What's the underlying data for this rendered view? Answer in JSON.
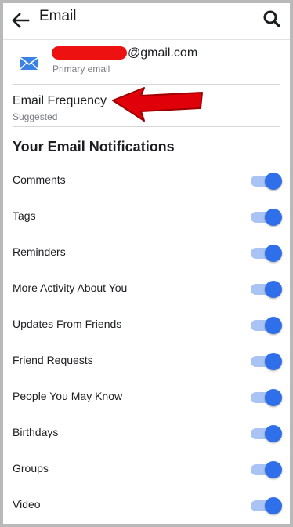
{
  "header": {
    "title": "Email"
  },
  "email": {
    "domain_text": "@gmail.com",
    "subtitle": "Primary email"
  },
  "frequency": {
    "title": "Email Frequency",
    "subtitle": "Suggested"
  },
  "section": {
    "title": "Your Email Notifications"
  },
  "notifications": [
    {
      "label": "Comments",
      "on": true
    },
    {
      "label": "Tags",
      "on": true
    },
    {
      "label": "Reminders",
      "on": true
    },
    {
      "label": "More Activity About You",
      "on": true
    },
    {
      "label": "Updates From Friends",
      "on": true
    },
    {
      "label": "Friend Requests",
      "on": true
    },
    {
      "label": "People You May Know",
      "on": true
    },
    {
      "label": "Birthdays",
      "on": true
    },
    {
      "label": "Groups",
      "on": true
    },
    {
      "label": "Video",
      "on": true
    }
  ],
  "colors": {
    "accent": "#2f6fea",
    "track": "#a9c4f4",
    "annotation_arrow": "#e0000a",
    "redaction": "#ee1111"
  },
  "icons": [
    "back-arrow-icon",
    "search-icon",
    "mail-icon",
    "annotation-arrow-icon"
  ]
}
